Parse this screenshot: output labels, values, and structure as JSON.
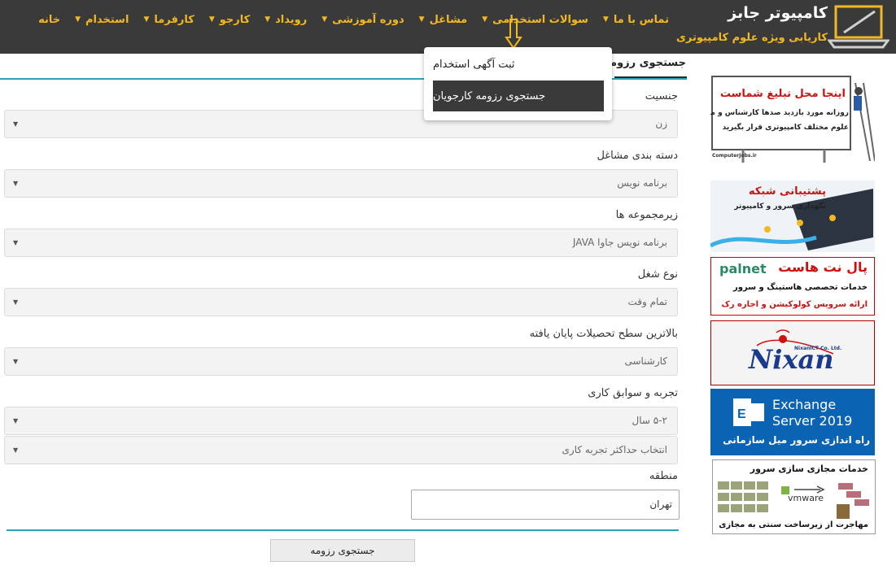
{
  "header": {
    "brand_title": "کامپیوتر جابز",
    "brand_subtitle": "کاریابی ویژه علوم کامپیوتری",
    "nav": [
      {
        "label": "خانه",
        "name": "nav-home",
        "home": true
      },
      {
        "label": "استخدام",
        "name": "nav-estekhdam"
      },
      {
        "label": "کارفرما",
        "name": "nav-karfarma"
      },
      {
        "label": "کارجو",
        "name": "nav-karjoo"
      },
      {
        "label": "رویداد",
        "name": "nav-rooydad"
      },
      {
        "label": "دوره آموزشی",
        "name": "nav-dore-amoozeshi"
      },
      {
        "label": "مشاغل",
        "name": "nav-mashaghel"
      },
      {
        "label": "سوالات استخدامی",
        "name": "nav-soalat-estekhdami"
      },
      {
        "label": "تماس با ما",
        "name": "nav-tamas"
      }
    ]
  },
  "dropdown": {
    "items": [
      "ثبت آگهی استخدام",
      "جستجوی رزومه کارجویان"
    ]
  },
  "form": {
    "title": "جستجوی رزومه",
    "gender_label": "جنسیت",
    "gender_value": "زن",
    "category_label": "دسته بندی مشاغل",
    "category_value": "برنامه نویس",
    "subcategory_label": "زیرمجموعه ها",
    "subcategory_value": "برنامه نویس جاوا JAVA",
    "jobtype_label": "نوع شغل",
    "jobtype_value": "تمام وقت",
    "education_label": "بالاترین سطح تحصیلات پایان یافته",
    "education_value": "کارشناسی",
    "experience_label": "تجربه و سوابق کاری",
    "experience_min_value": "۵-۲ سال",
    "experience_max_placeholder": "انتخاب حداکثر تجربه کاری",
    "region_label": "منطقه",
    "region_value": "تهران",
    "submit_label": "جستجوی رزومه"
  },
  "ads": {
    "ad1_line1": "اینجا محل تبلیغ شماست",
    "ad1_line2": "روزانه مورد بازدید صدها کارشناس و مدیر",
    "ad1_line3": "علوم مختلف کامپیوتری قرار بگیرید",
    "ad1_url": "ComputerJobs.ir",
    "ad2_line1": "پشتیبانی شبکه",
    "ad2_line2": "نگهداری سرور و کامپیوتر",
    "ad3_brand": "palnet",
    "ad3_title": "پال نت هاست",
    "ad3_line1": "خدمات تخصصی هاستینگ و سرور",
    "ad3_line2": "ارائه سرویس کولوکیشن و اجاره رک",
    "ad4_brand": "Nixan",
    "ad4_small": "NixanICT Co. Ltd.",
    "ad5_line1": "Exchange",
    "ad5_line2": "Server 2019",
    "ad5_line3": "راه اندازی سرور میل سازمانی",
    "ad6_line1": "خدمات مجازی سازی سرور",
    "ad6_brand": "vmware",
    "ad6_line2": "مهاجرت از زیرساخت سنتی به مجازی"
  },
  "colors": {
    "header_bg": "#3a3a3a",
    "accent_gold": "#f2b822",
    "teal_line": "#2aa7b3",
    "exchange_blue": "#0a63b3",
    "ad_red": "#cc1111"
  }
}
